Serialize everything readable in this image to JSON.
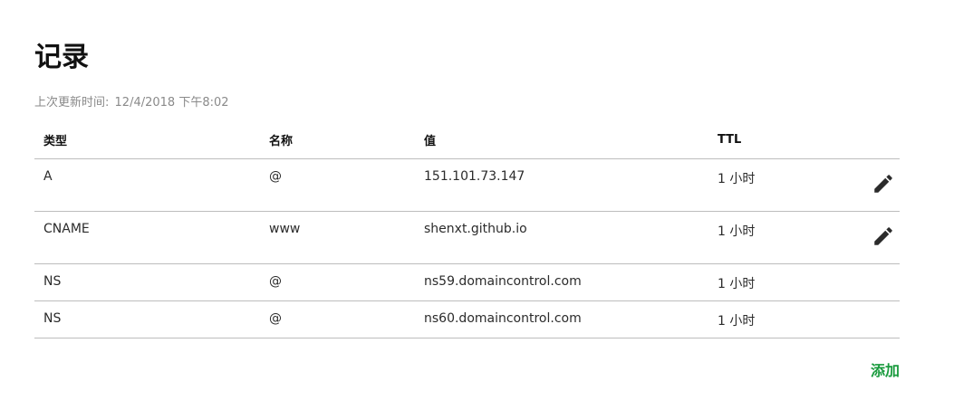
{
  "page": {
    "title": "记录",
    "updated_label": "上次更新时间:",
    "updated_value": "12/4/2018 下午8:02"
  },
  "table": {
    "headers": {
      "type": "类型",
      "name": "名称",
      "value": "值",
      "ttl": "TTL"
    },
    "rows": [
      {
        "type": "A",
        "name": "@",
        "value": "151.101.73.147",
        "ttl": "1 小时",
        "editable": true
      },
      {
        "type": "CNAME",
        "name": "www",
        "value": "shenxt.github.io",
        "ttl": "1 小时",
        "editable": true
      },
      {
        "type": "NS",
        "name": "@",
        "value": "ns59.domaincontrol.com",
        "ttl": "1 小时",
        "editable": false
      },
      {
        "type": "NS",
        "name": "@",
        "value": "ns60.domaincontrol.com",
        "ttl": "1 小时",
        "editable": false
      }
    ]
  },
  "actions": {
    "add_label": "添加",
    "edit_icon": "pencil-icon"
  },
  "colors": {
    "accent": "#1a9b3e",
    "muted_text": "#8a8a8a",
    "divider": "#bdbdbd"
  }
}
